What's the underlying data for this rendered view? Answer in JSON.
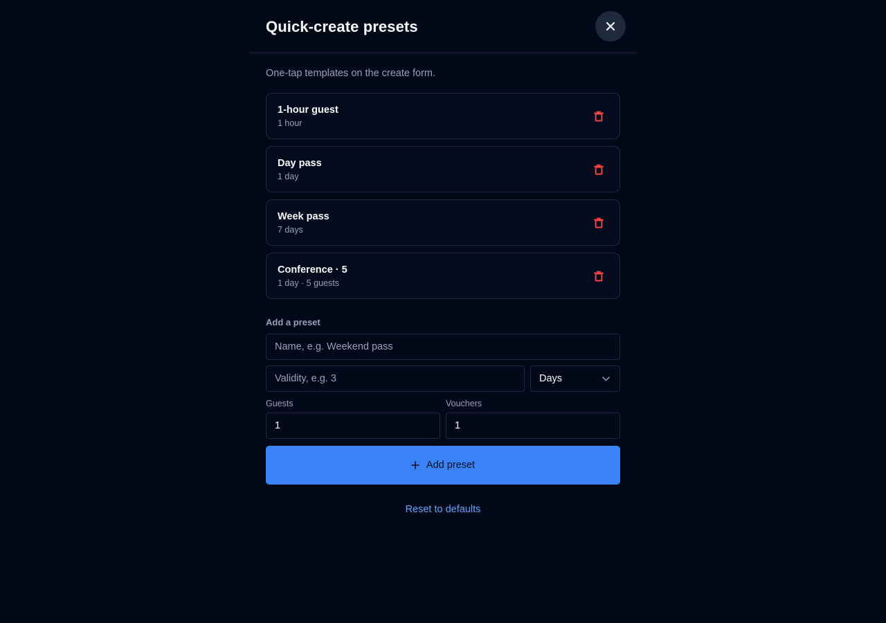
{
  "header": {
    "title": "Quick-create presets"
  },
  "subtitle": "One-tap templates on the create form.",
  "presets": [
    {
      "name": "1-hour guest",
      "detail": "1 hour"
    },
    {
      "name": "Day pass",
      "detail": "1 day"
    },
    {
      "name": "Week pass",
      "detail": "7 days"
    },
    {
      "name": "Conference · 5",
      "detail": "1 day · 5 guests"
    }
  ],
  "add_form": {
    "section_label": "Add a preset",
    "name_placeholder": "Name, e.g. Weekend pass",
    "validity_placeholder": "Validity, e.g. 3",
    "unit_selected": "Days",
    "guests_label": "Guests",
    "guests_value": "1",
    "vouchers_label": "Vouchers",
    "vouchers_value": "1",
    "add_button_label": "Add preset"
  },
  "reset_label": "Reset to defaults",
  "colors": {
    "background": "#020817",
    "accent": "#3b82f6",
    "danger": "#ef4444",
    "link": "#60a5fa"
  },
  "icons": {
    "close": "close-icon",
    "delete": "trash-icon",
    "dropdown": "chevron-down-icon",
    "add": "plus-icon"
  }
}
